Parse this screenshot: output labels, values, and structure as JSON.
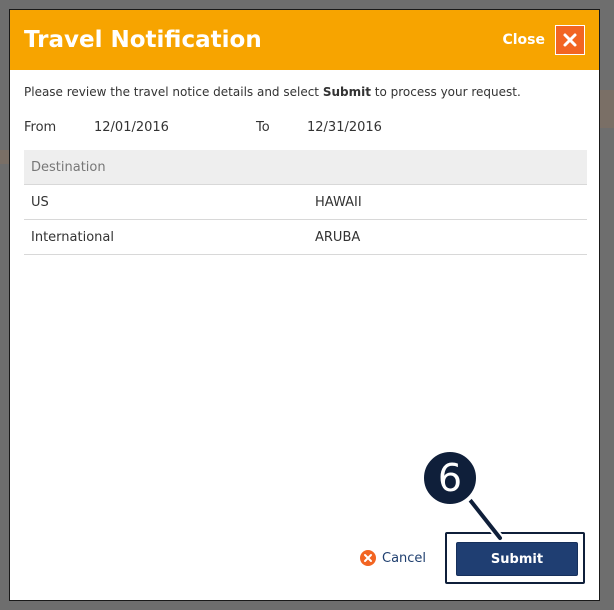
{
  "modal": {
    "title": "Travel Notification",
    "close_label": "Close",
    "intro_before": "Please review the travel notice details and select ",
    "intro_bold": "Submit",
    "intro_after": " to process your request.",
    "from_label": "From",
    "from_value": "12/01/2016",
    "to_label": "To",
    "to_value": "12/31/2016",
    "table_header": "Destination",
    "destinations": [
      {
        "region": "US",
        "place": "HAWAII"
      },
      {
        "region": "International",
        "place": "ARUBA"
      }
    ],
    "cancel_label": "Cancel",
    "submit_label": "Submit"
  },
  "step_badge": "6",
  "colors": {
    "header": "#f7a400",
    "close_button": "#f26522",
    "submit_button": "#1f3e72",
    "badge": "#0f1f3a"
  },
  "icons": {
    "close": "close-icon",
    "cancel": "cancel-icon"
  }
}
